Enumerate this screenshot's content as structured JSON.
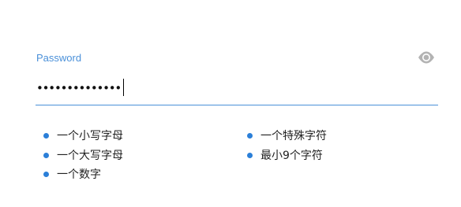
{
  "password_field": {
    "label": "Password",
    "masked_value": "••••••••••••••",
    "eye_icon": "eye-icon"
  },
  "requirements": {
    "left": [
      {
        "text": "一个小写字母"
      },
      {
        "text": "一个大写字母"
      },
      {
        "text": "一个数字"
      }
    ],
    "right": [
      {
        "text": "一个特殊字符"
      },
      {
        "text": "最小9个字符"
      }
    ]
  },
  "colors": {
    "accent": "#4a90d9",
    "bullet": "#2b7fd8",
    "eye": "#aaaaaa"
  }
}
